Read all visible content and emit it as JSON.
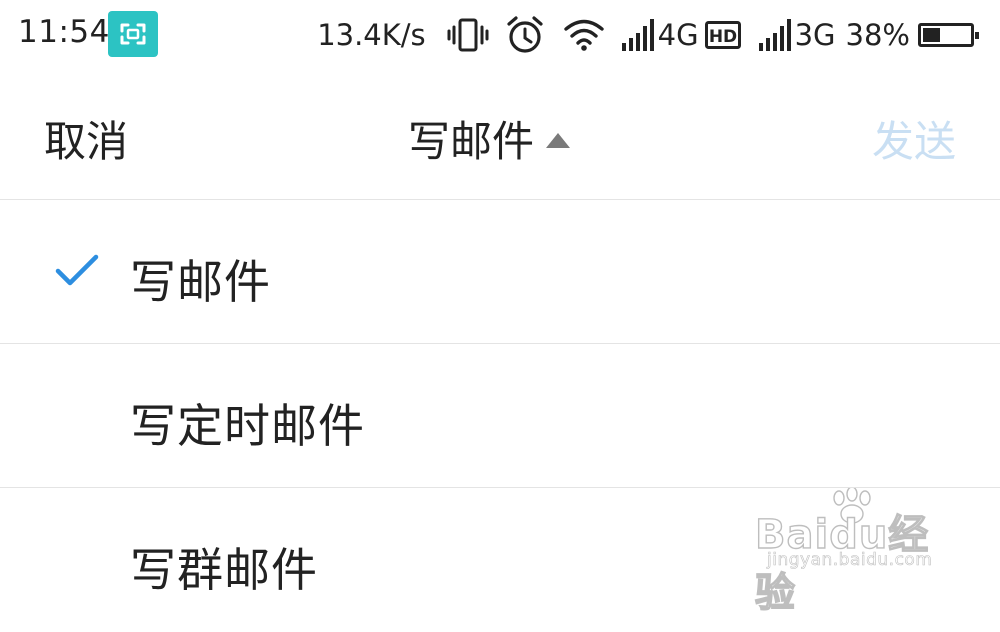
{
  "status_bar": {
    "time": "11:54",
    "net_speed": "13.4K/s",
    "sim1_network": "4G",
    "sim1_badge": "HD",
    "sim2_network": "3G",
    "battery_percent": "38%",
    "battery_level": 0.38,
    "icons": [
      "screenshot-icon",
      "vibrate-icon",
      "alarm-icon",
      "wifi-icon",
      "signal-icon",
      "hd-icon",
      "signal-icon",
      "battery-icon"
    ]
  },
  "navbar": {
    "cancel_label": "取消",
    "title": "写邮件",
    "send_label": "发送",
    "send_color": "#c9dff3"
  },
  "menu": {
    "items": [
      {
        "label": "写邮件",
        "selected": true
      },
      {
        "label": "写定时邮件",
        "selected": false
      },
      {
        "label": "写群邮件",
        "selected": false
      }
    ],
    "check_color": "#2d8ee0"
  },
  "watermark": {
    "logo_text": "Baidu经验",
    "url": "jingyan.baidu.com"
  }
}
